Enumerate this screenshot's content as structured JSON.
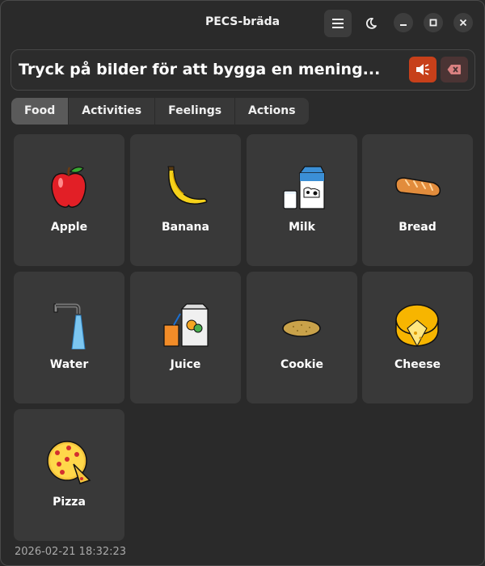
{
  "window": {
    "title": "PECS-bräda",
    "icons": [
      "hamburger-menu-icon",
      "moon-icon",
      "minimize-icon",
      "maximize-icon",
      "close-icon"
    ]
  },
  "sentence": {
    "placeholder": "Tryck på bilder för att bygga en mening...",
    "speak_icon": "speaker-icon",
    "clear_icon": "backspace-icon",
    "speak_color": "#c7401a"
  },
  "tabs": [
    {
      "label": "Food",
      "active": true
    },
    {
      "label": "Activities",
      "active": false
    },
    {
      "label": "Feelings",
      "active": false
    },
    {
      "label": "Actions",
      "active": false
    }
  ],
  "cards": [
    {
      "label": "Apple",
      "icon": "apple-icon"
    },
    {
      "label": "Banana",
      "icon": "banana-icon"
    },
    {
      "label": "Milk",
      "icon": "milk-icon"
    },
    {
      "label": "Bread",
      "icon": "bread-icon"
    },
    {
      "label": "Water",
      "icon": "water-tap-icon"
    },
    {
      "label": "Juice",
      "icon": "juice-icon"
    },
    {
      "label": "Cookie",
      "icon": "cookie-icon"
    },
    {
      "label": "Cheese",
      "icon": "cheese-icon"
    },
    {
      "label": "Pizza",
      "icon": "pizza-icon"
    }
  ],
  "footer": {
    "timestamp": "2026-02-21 18:32:23"
  }
}
